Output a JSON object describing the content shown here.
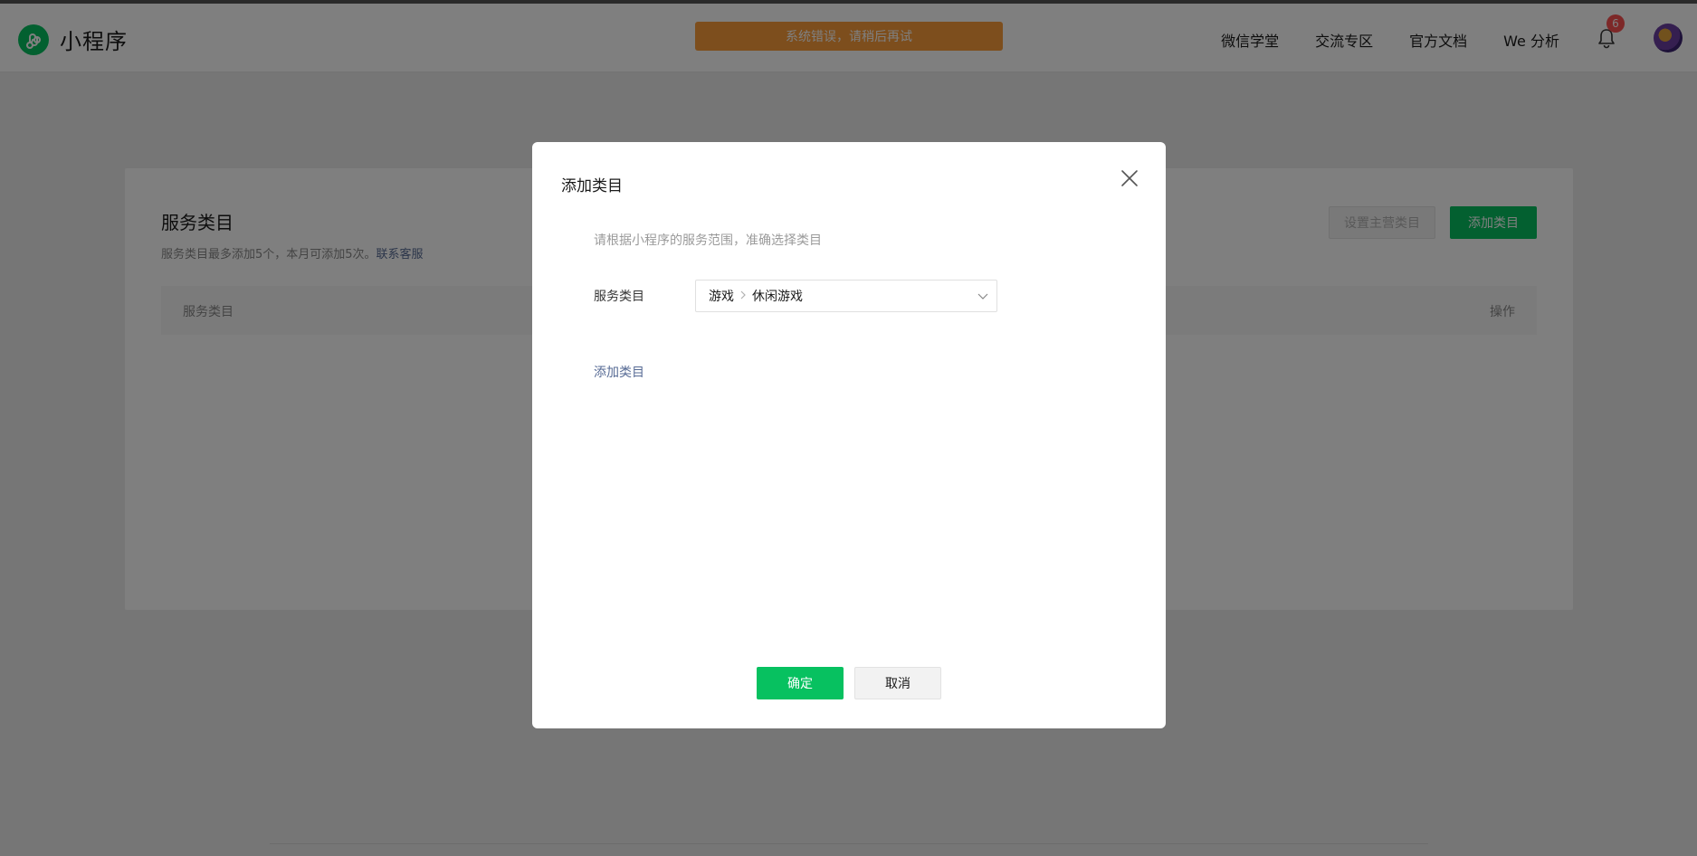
{
  "header": {
    "logo_text": "小程序",
    "error_toast": "系统错误，请稍后再试",
    "nav": [
      "微信学堂",
      "交流专区",
      "官方文档",
      "We 分析"
    ],
    "notification_count": "6"
  },
  "page": {
    "title": "服务类目",
    "desc": "服务类目最多添加5个，本月可添加5次。",
    "desc_link": "联系客服",
    "btn_set_primary": "设置主营类目",
    "btn_add": "添加类目",
    "table_headers": [
      "服务类目",
      "操作"
    ]
  },
  "modal": {
    "title": "添加类目",
    "tip": "请根据小程序的服务范围，准确选择类目",
    "field_label": "服务类目",
    "select_path": [
      "游戏",
      "休闲游戏"
    ],
    "add_link": "添加类目",
    "btn_ok": "确定",
    "btn_cancel": "取消"
  },
  "colors": {
    "brand_green": "#07c160",
    "toast_orange": "#fa9d3b",
    "link_blue": "#576b95",
    "badge_red": "#fa5151"
  },
  "icons": [
    "miniprogram-logo-icon",
    "bell-icon",
    "close-icon",
    "chevron-down-icon",
    "chevron-right-icon"
  ]
}
